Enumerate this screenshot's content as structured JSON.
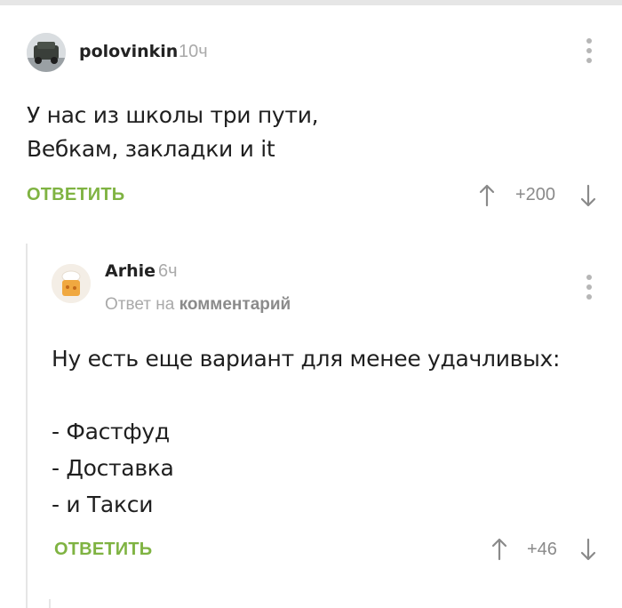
{
  "comments": [
    {
      "username": "polovinkin",
      "time": "10ч",
      "avatar_icon": "car-photo-avatar",
      "text_lines": [
        "У нас из школы три пути,",
        "Вебкам, закладки и it"
      ],
      "reply_label": "ОТВЕТИТЬ",
      "rating": "+200"
    },
    {
      "username": "Arhie",
      "time": "6ч",
      "avatar_icon": "cake-avatar",
      "reply_to_prefix": "Ответ на",
      "reply_to_link": "комментарий",
      "text_lines": [
        "Ну есть еще вариант для менее удачливых:",
        "",
        "- Фастфуд",
        "- Доставка",
        "- и Такси"
      ],
      "reply_label": "ОТВЕТИТЬ",
      "rating": "+46"
    }
  ],
  "colors": {
    "accent_green": "#7fb342",
    "muted_gray": "#aaaaaa",
    "text": "#1f1f1f"
  }
}
